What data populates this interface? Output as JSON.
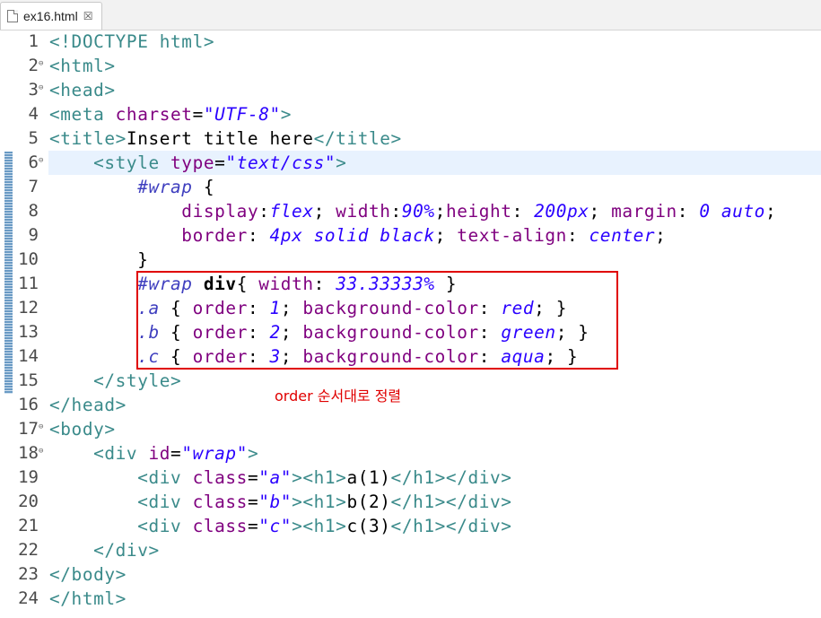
{
  "tab": {
    "title": "ex16.html",
    "close": "☒"
  },
  "annotation": "order 순서대로 정렬",
  "lines": [
    {
      "n": "1",
      "fold": "",
      "segs": [
        [
          "tg",
          "<!DOCTYPE html>"
        ]
      ]
    },
    {
      "n": "2",
      "fold": "⊖",
      "segs": [
        [
          "tg",
          "<html>"
        ]
      ]
    },
    {
      "n": "3",
      "fold": "⊖",
      "segs": [
        [
          "tg",
          "<head>"
        ]
      ]
    },
    {
      "n": "4",
      "fold": "",
      "segs": [
        [
          "tg",
          "<meta "
        ],
        [
          "at",
          "charset"
        ],
        [
          "tx",
          "="
        ],
        [
          "sv",
          "\"UTF-8\""
        ],
        [
          "tg",
          ">"
        ]
      ]
    },
    {
      "n": "5",
      "fold": "",
      "segs": [
        [
          "tg",
          "<title>"
        ],
        [
          "tx",
          "Insert title here"
        ],
        [
          "tg",
          "</title>"
        ]
      ]
    },
    {
      "n": "6",
      "fold": "⊖",
      "segs": [
        [
          "tx",
          "    "
        ],
        [
          "tg",
          "<style "
        ],
        [
          "at",
          "type"
        ],
        [
          "tx",
          "="
        ],
        [
          "sv",
          "\"text/css\""
        ],
        [
          "tg",
          ">"
        ]
      ]
    },
    {
      "n": "7",
      "fold": "",
      "segs": [
        [
          "tx",
          "        "
        ],
        [
          "sl",
          "#wrap"
        ],
        [
          "tx",
          " {"
        ]
      ]
    },
    {
      "n": "8",
      "fold": "",
      "segs": [
        [
          "tx",
          "            "
        ],
        [
          "cp",
          "display"
        ],
        [
          "tx",
          ":"
        ],
        [
          "cv",
          "flex"
        ],
        [
          "tx",
          "; "
        ],
        [
          "cp",
          "width"
        ],
        [
          "tx",
          ":"
        ],
        [
          "cv",
          "90%"
        ],
        [
          "tx",
          ";"
        ],
        [
          "cp",
          "height"
        ],
        [
          "tx",
          ": "
        ],
        [
          "cv",
          "200px"
        ],
        [
          "tx",
          "; "
        ],
        [
          "cp",
          "margin"
        ],
        [
          "tx",
          ": "
        ],
        [
          "cv",
          "0 auto"
        ],
        [
          "tx",
          ";"
        ]
      ]
    },
    {
      "n": "9",
      "fold": "",
      "segs": [
        [
          "tx",
          "            "
        ],
        [
          "cp",
          "border"
        ],
        [
          "tx",
          ": "
        ],
        [
          "cv",
          "4px solid black"
        ],
        [
          "tx",
          "; "
        ],
        [
          "cp",
          "text-align"
        ],
        [
          "tx",
          ": "
        ],
        [
          "cv",
          "center"
        ],
        [
          "tx",
          ";"
        ]
      ]
    },
    {
      "n": "10",
      "fold": "",
      "segs": [
        [
          "tx",
          "        }"
        ]
      ]
    },
    {
      "n": "11",
      "fold": "",
      "segs": [
        [
          "tx",
          "        "
        ],
        [
          "sl",
          "#wrap"
        ],
        [
          "tx",
          " "
        ],
        [
          "bold",
          "div"
        ],
        [
          "tx",
          "{ "
        ],
        [
          "cp",
          "width"
        ],
        [
          "tx",
          ": "
        ],
        [
          "cv",
          "33.33333%"
        ],
        [
          "tx",
          " }"
        ]
      ]
    },
    {
      "n": "12",
      "fold": "",
      "segs": [
        [
          "tx",
          "        "
        ],
        [
          "sl",
          ".a"
        ],
        [
          "tx",
          " { "
        ],
        [
          "cp",
          "order"
        ],
        [
          "tx",
          ": "
        ],
        [
          "cv",
          "1"
        ],
        [
          "tx",
          "; "
        ],
        [
          "cp",
          "background-color"
        ],
        [
          "tx",
          ": "
        ],
        [
          "cv",
          "red"
        ],
        [
          "tx",
          "; }"
        ]
      ]
    },
    {
      "n": "13",
      "fold": "",
      "segs": [
        [
          "tx",
          "        "
        ],
        [
          "sl",
          ".b"
        ],
        [
          "tx",
          " { "
        ],
        [
          "cp",
          "order"
        ],
        [
          "tx",
          ": "
        ],
        [
          "cv",
          "2"
        ],
        [
          "tx",
          "; "
        ],
        [
          "cp",
          "background-color"
        ],
        [
          "tx",
          ": "
        ],
        [
          "cv",
          "green"
        ],
        [
          "tx",
          "; }"
        ]
      ]
    },
    {
      "n": "14",
      "fold": "",
      "segs": [
        [
          "tx",
          "        "
        ],
        [
          "sl",
          ".c"
        ],
        [
          "tx",
          " { "
        ],
        [
          "cp",
          "order"
        ],
        [
          "tx",
          ": "
        ],
        [
          "cv",
          "3"
        ],
        [
          "tx",
          "; "
        ],
        [
          "cp",
          "background-color"
        ],
        [
          "tx",
          ": "
        ],
        [
          "cv",
          "aqua"
        ],
        [
          "tx",
          "; }"
        ]
      ]
    },
    {
      "n": "15",
      "fold": "",
      "segs": [
        [
          "tx",
          "    "
        ],
        [
          "tg",
          "</style>"
        ]
      ]
    },
    {
      "n": "16",
      "fold": "",
      "segs": [
        [
          "tg",
          "</head>"
        ]
      ]
    },
    {
      "n": "17",
      "fold": "⊖",
      "segs": [
        [
          "tg",
          "<body>"
        ]
      ]
    },
    {
      "n": "18",
      "fold": "⊖",
      "segs": [
        [
          "tx",
          "    "
        ],
        [
          "tg",
          "<div "
        ],
        [
          "at",
          "id"
        ],
        [
          "tx",
          "="
        ],
        [
          "sv",
          "\"wrap\""
        ],
        [
          "tg",
          ">"
        ]
      ]
    },
    {
      "n": "19",
      "fold": "",
      "segs": [
        [
          "tx",
          "        "
        ],
        [
          "tg",
          "<div "
        ],
        [
          "at",
          "class"
        ],
        [
          "tx",
          "="
        ],
        [
          "sv",
          "\"a\""
        ],
        [
          "tg",
          "><h1>"
        ],
        [
          "tx",
          "a(1)"
        ],
        [
          "tg",
          "</h1></div>"
        ]
      ]
    },
    {
      "n": "20",
      "fold": "",
      "segs": [
        [
          "tx",
          "        "
        ],
        [
          "tg",
          "<div "
        ],
        [
          "at",
          "class"
        ],
        [
          "tx",
          "="
        ],
        [
          "sv",
          "\"b\""
        ],
        [
          "tg",
          "><h1>"
        ],
        [
          "tx",
          "b(2)"
        ],
        [
          "tg",
          "</h1></div>"
        ]
      ]
    },
    {
      "n": "21",
      "fold": "",
      "segs": [
        [
          "tx",
          "        "
        ],
        [
          "tg",
          "<div "
        ],
        [
          "at",
          "class"
        ],
        [
          "tx",
          "="
        ],
        [
          "sv",
          "\"c\""
        ],
        [
          "tg",
          "><h1>"
        ],
        [
          "tx",
          "c(3)"
        ],
        [
          "tg",
          "</h1></div>"
        ]
      ]
    },
    {
      "n": "22",
      "fold": "",
      "segs": [
        [
          "tx",
          "    "
        ],
        [
          "tg",
          "</div>"
        ]
      ]
    },
    {
      "n": "23",
      "fold": "",
      "segs": [
        [
          "tg",
          "</body>"
        ]
      ]
    },
    {
      "n": "24",
      "fold": "",
      "segs": [
        [
          "tg",
          "</html>"
        ]
      ]
    }
  ]
}
